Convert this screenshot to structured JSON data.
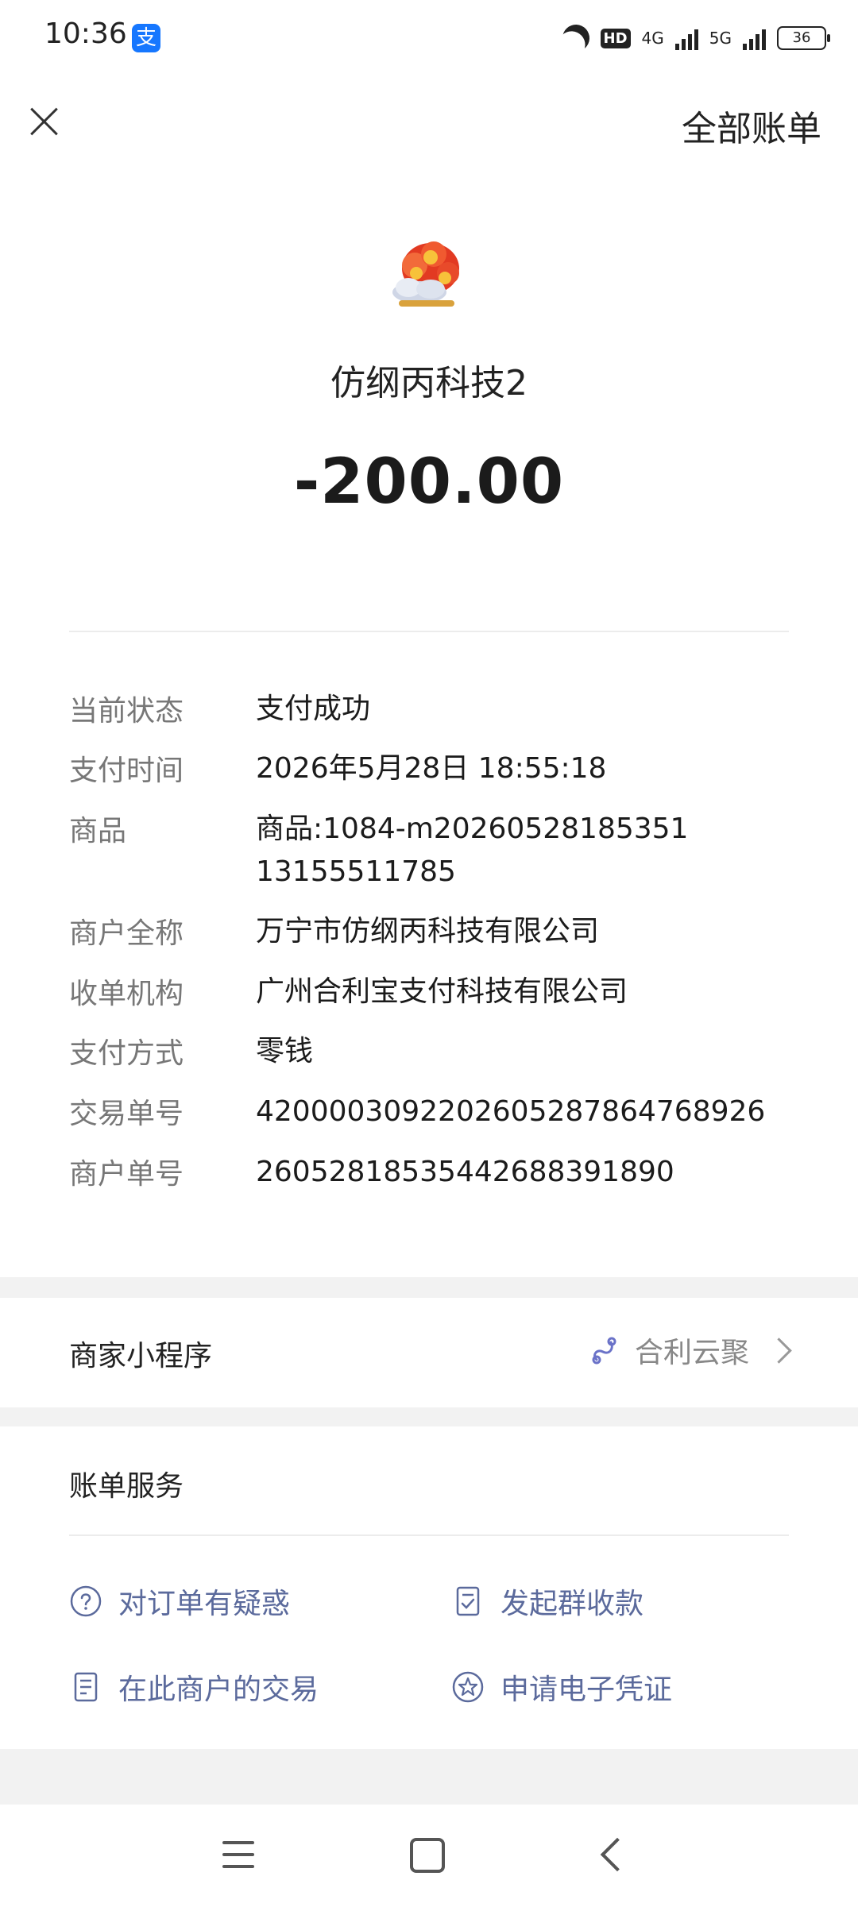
{
  "status_bar": {
    "time": "10:36",
    "app_badge": "支",
    "network_hd": "HD",
    "network_4g": "4G",
    "network_5g": "5G",
    "battery": "36"
  },
  "header": {
    "right_link": "全部账单"
  },
  "merchant": {
    "name": "仿纲丙科技2",
    "amount": "-200.00"
  },
  "details": [
    {
      "label": "当前状态",
      "value": "支付成功"
    },
    {
      "label": "支付时间",
      "value": "2026年5月28日 18:55:18"
    },
    {
      "label": "商品",
      "value": "商品:1084-m20260528185351131555117​85"
    },
    {
      "label": "商户全称",
      "value": "万宁市仿纲丙科技有限公司"
    },
    {
      "label": "收单机构",
      "value": "广州合利宝支付科技有限公司"
    },
    {
      "label": "支付方式",
      "value": "零钱"
    },
    {
      "label": "交易单号",
      "value": "4200003092202605287864768926"
    },
    {
      "label": "商户单号",
      "value": "260528185354426883918​90"
    }
  ],
  "mini_program": {
    "label": "商家小程序",
    "name": "合利云聚"
  },
  "bill_services": {
    "title": "账单服务",
    "items": [
      {
        "label": "对订单有疑惑",
        "icon": "question-circle-icon"
      },
      {
        "label": "发起群收款",
        "icon": "checklist-icon"
      },
      {
        "label": "在此商户的交易",
        "icon": "document-icon"
      },
      {
        "label": "申请电子凭证",
        "icon": "star-circle-icon"
      }
    ]
  },
  "colors": {
    "link_blue": "#5b6a9c",
    "label_gray": "#777777",
    "band_gray": "#f2f2f2",
    "mini_icon": "#6a72c8"
  }
}
